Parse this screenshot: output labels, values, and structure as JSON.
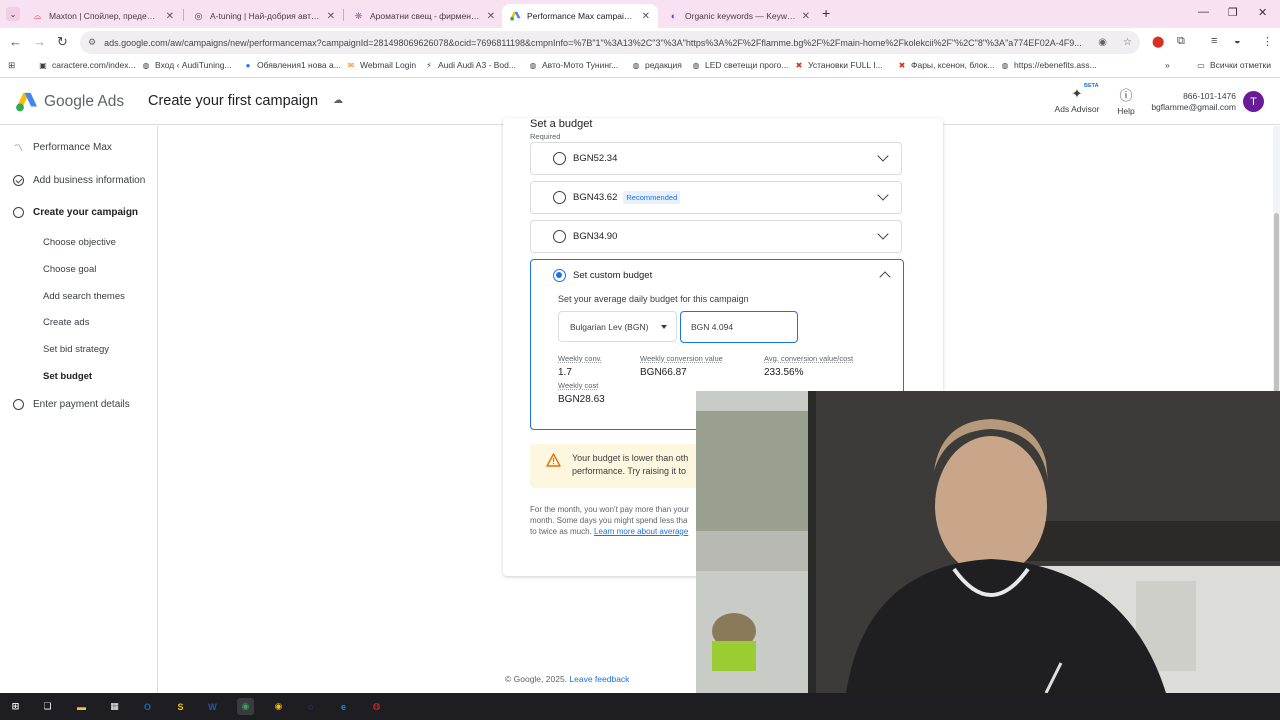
{
  "browser": {
    "tabs": [
      {
        "title": "Maxton | Спойлер, преден ли...",
        "icon": "maxton-favicon",
        "color": "#d93025"
      },
      {
        "title": "A-tuning | Най-добрия авто са...",
        "icon": "atuning-favicon",
        "color": "#3c4043"
      },
      {
        "title": "Ароматни свещ - фирмен ко...",
        "icon": "candle-favicon",
        "color": "#9c6b9a"
      },
      {
        "title": "Performance Max campaign - ...",
        "icon": "google-ads-favicon",
        "color": "#34a853",
        "active": true
      },
      {
        "title": "Organic keywords — Keyword ...",
        "icon": "semrush-favicon",
        "color": "#5f3dc4"
      }
    ],
    "url": "ads.google.com/aw/campaigns/new/performancemax?campaignId=281498069626078&ocid=7696811198&cmpnInfo=%7B\"1\"%3A13%2C\"3\"%3A\"https%3A%2F%2Fflamme.bg%2F%2Fmain-home%2Fkolekcii%2F\"%2C\"8\"%3A\"a774EF02A-4F9...",
    "bookmarks": [
      {
        "label": "caractere.com/index...",
        "icon": "bookmark-page-icon"
      },
      {
        "label": "Вход ‹ AudiTuning...",
        "icon": "bookmark-wp-icon"
      },
      {
        "label": "Обявления1 нова а...",
        "icon": "facebook-icon"
      },
      {
        "label": "Webmail Login",
        "icon": "webmail-icon"
      },
      {
        "label": "Audi Audi A3 - Bod...",
        "icon": "audi-icon"
      },
      {
        "label": "Авто-Мото Тунинг...",
        "icon": "bookmark-wp-icon"
      },
      {
        "label": "редакция",
        "icon": "bookmark-wp-icon"
      },
      {
        "label": "LED светещи прого...",
        "icon": "bookmark-wp-icon"
      },
      {
        "label": "Установки FULL I...",
        "icon": "bookmark-x-icon"
      },
      {
        "label": "Фары, ксенон, блок...",
        "icon": "bookmark-x-icon"
      },
      {
        "label": "https://ebenefits.ass...",
        "icon": "bookmark-wp-icon"
      }
    ],
    "all_bookmarks_label": "Всички отметки"
  },
  "ads_header": {
    "product_name": "Google Ads",
    "page_title": "Create your first campaign",
    "advisor_label": "Ads Advisor",
    "advisor_badge": "BETA",
    "help_label": "Help",
    "phone": "866-101-1476",
    "email": "bgflamme@gmail.com",
    "avatar_letter": "T",
    "avatar_color": "#6a1b9a"
  },
  "left_nav": {
    "items": [
      {
        "label": "Performance Max",
        "icon": "trend-icon"
      },
      {
        "label": "Add business information",
        "icon": "check-circle-icon"
      },
      {
        "label": "Create your campaign",
        "icon": "circle-icon"
      },
      {
        "label": "Enter payment details",
        "icon": "circle-icon"
      }
    ],
    "sub_items": [
      {
        "label": "Choose objective"
      },
      {
        "label": "Choose goal"
      },
      {
        "label": "Add search themes"
      },
      {
        "label": "Create ads"
      },
      {
        "label": "Set bid strategy"
      },
      {
        "label": "Set budget",
        "active": true
      }
    ]
  },
  "budget": {
    "section_title": "Set a budget",
    "required_label": "Required",
    "options": [
      {
        "amount": "BGN52.34",
        "badge": ""
      },
      {
        "amount": "BGN43.62",
        "badge": "Recommended"
      },
      {
        "amount": "BGN34.90",
        "badge": ""
      }
    ],
    "custom": {
      "label": "Set custom budget",
      "description": "Set your average daily budget for this campaign",
      "currency": "Bulgarian Lev (BGN)",
      "input_value": "BGN 4.094",
      "metrics": [
        {
          "label": "Weekly conv.",
          "value": "1.7"
        },
        {
          "label": "Weekly conversion value",
          "value": "BGN66.87"
        },
        {
          "label": "Avg. conversion value/cost",
          "value": "233.56%"
        },
        {
          "label": "Weekly cost",
          "value": "BGN28.63"
        }
      ]
    },
    "warning": {
      "line1": "Your budget is lower than oth",
      "line2": "performance. Try raising it to"
    },
    "footnote": {
      "line1": "For the month, you won't pay more than your",
      "line2": "month. Some days you might spend less tha",
      "line3": "to twice as much.",
      "link": "Learn more about average"
    }
  },
  "footer": {
    "copyright": "© Google, 2025.",
    "feedback_link": "Leave feedback"
  },
  "taskbar": {
    "apps": [
      {
        "icon": "windows-start-icon",
        "color": "#ffffff"
      },
      {
        "icon": "task-view-icon",
        "color": "#ffffff"
      },
      {
        "icon": "file-explorer-icon",
        "color": "#f3c13a"
      },
      {
        "icon": "store-icon",
        "color": "#ffffff"
      },
      {
        "icon": "outlook-icon",
        "color": "#0f6cbd"
      },
      {
        "icon": "sketch-app-icon",
        "color": "#f0c419"
      },
      {
        "icon": "word-icon",
        "color": "#185abd"
      },
      {
        "icon": "chrome-icon",
        "color": "#34a853",
        "active": true
      },
      {
        "icon": "chrome-icon",
        "color": "#fbbc04"
      },
      {
        "icon": "viber-icon",
        "color": "#7360f2"
      },
      {
        "icon": "edge-icon",
        "color": "#0c8ce9"
      },
      {
        "icon": "app-icon",
        "color": "#d93025"
      }
    ]
  }
}
